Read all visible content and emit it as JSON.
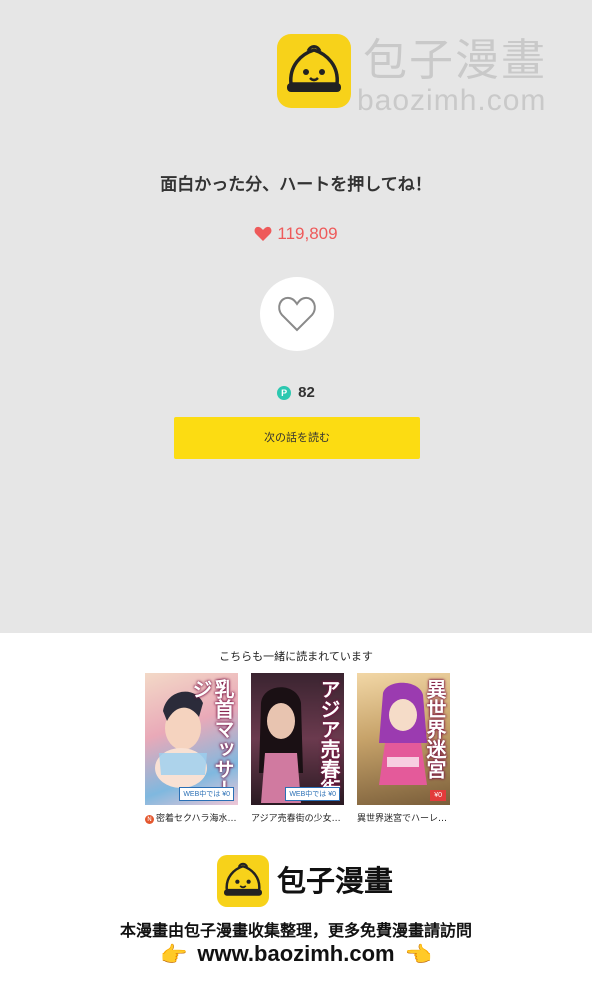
{
  "watermark": {
    "title": "包子漫畫",
    "url": "baozimh.com",
    "icon": "baozi-logo-icon"
  },
  "heading": "面白かった分、ハートを押してね！",
  "likes": {
    "count": "119,809",
    "icon": "heart-filled-icon",
    "color": "#ee5a5a"
  },
  "heart_button": {
    "icon": "heart-outline-icon"
  },
  "points": {
    "icon_letter": "P",
    "value": "82",
    "color": "#2cc8b0"
  },
  "next_button": {
    "label": "次の話を読む",
    "color": "#fcdc12"
  },
  "recommendations": {
    "heading": "こちらも一緒に読まれています",
    "items": [
      {
        "badge": "N",
        "caption": "密着セクハラ海水…",
        "cover_text": "乳首マッサージ",
        "price": "WEB中では ¥0"
      },
      {
        "badge": "",
        "caption": "アジア売春街の少女…",
        "cover_text": "アジア売春街",
        "price": "WEB中では ¥0"
      },
      {
        "badge": "",
        "caption": "異世界迷宮でハーレ…",
        "cover_text": "異世界迷宮",
        "price": "¥0"
      }
    ]
  },
  "footer": {
    "brand": "包子漫畫",
    "line1": "本漫畫由包子漫畫收集整理，更多免費漫畫請訪問",
    "line2": "www.baozimh.com",
    "hand_left": "👉",
    "hand_right": "👈",
    "icon": "baozi-logo-icon"
  }
}
